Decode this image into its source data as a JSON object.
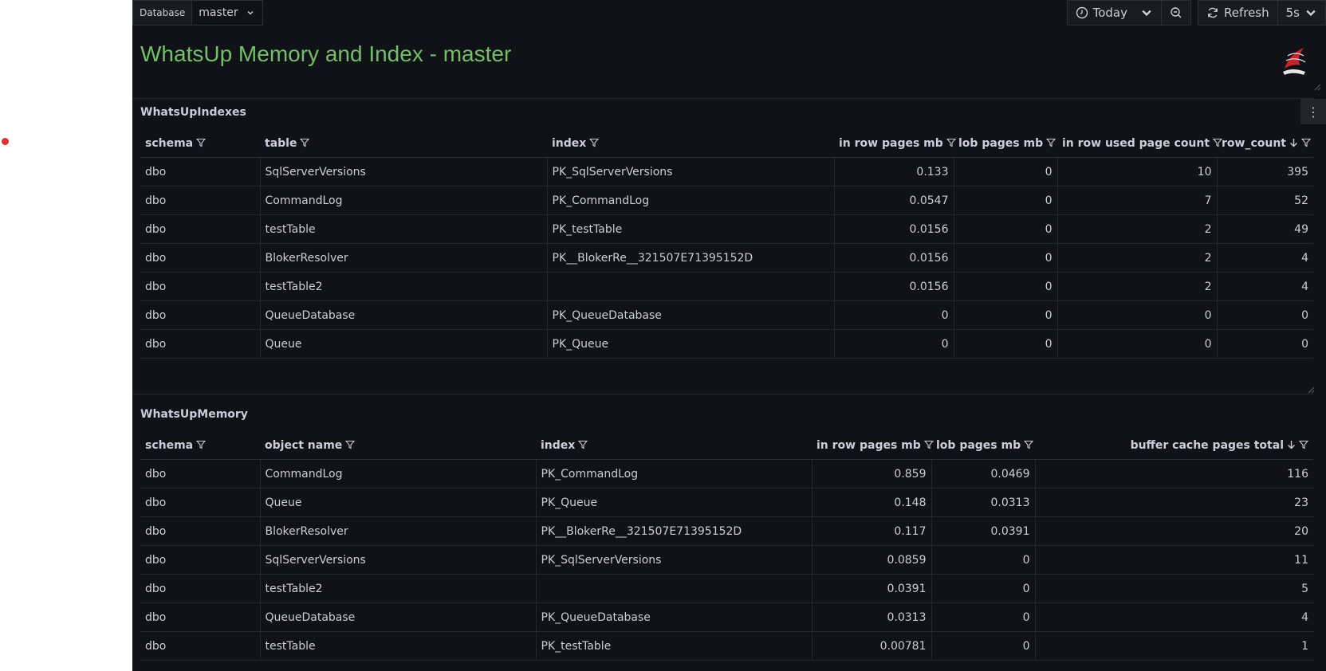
{
  "toolbar": {
    "variable_label": "Database",
    "variable_value": "master",
    "time_range": "Today",
    "refresh_label": "Refresh",
    "refresh_interval": "5s"
  },
  "title_panel": {
    "title": "WhatsUp Memory and Index - master",
    "logo_icon": "sql-server-icon"
  },
  "indexes_panel": {
    "title": "WhatsUpIndexes",
    "columns": [
      "schema",
      "table",
      "index",
      "in row pages mb",
      "lob pages mb",
      "in row used page count",
      "row_count"
    ],
    "sorted_column": "row_count",
    "rows": [
      [
        "dbo",
        "SqlServerVersions",
        "PK_SqlServerVersions",
        "0.133",
        "0",
        "10",
        "395"
      ],
      [
        "dbo",
        "CommandLog",
        "PK_CommandLog",
        "0.0547",
        "0",
        "7",
        "52"
      ],
      [
        "dbo",
        "testTable",
        "PK_testTable",
        "0.0156",
        "0",
        "2",
        "49"
      ],
      [
        "dbo",
        "BlokerResolver",
        "PK__BlokerRe__321507E71395152D",
        "0.0156",
        "0",
        "2",
        "4"
      ],
      [
        "dbo",
        "testTable2",
        "",
        "0.0156",
        "0",
        "2",
        "4"
      ],
      [
        "dbo",
        "QueueDatabase",
        "PK_QueueDatabase",
        "0",
        "0",
        "0",
        "0"
      ],
      [
        "dbo",
        "Queue",
        "PK_Queue",
        "0",
        "0",
        "0",
        "0"
      ]
    ]
  },
  "memory_panel": {
    "title": "WhatsUpMemory",
    "columns": [
      "schema",
      "object name",
      "index",
      "in row pages mb",
      "lob pages mb",
      "buffer cache pages total"
    ],
    "sorted_column": "buffer cache pages total",
    "rows": [
      [
        "dbo",
        "CommandLog",
        "PK_CommandLog",
        "0.859",
        "0.0469",
        "116"
      ],
      [
        "dbo",
        "Queue",
        "PK_Queue",
        "0.148",
        "0.0313",
        "23"
      ],
      [
        "dbo",
        "BlokerResolver",
        "PK__BlokerRe__321507E71395152D",
        "0.117",
        "0.0391",
        "20"
      ],
      [
        "dbo",
        "SqlServerVersions",
        "PK_SqlServerVersions",
        "0.0859",
        "0",
        "11"
      ],
      [
        "dbo",
        "testTable2",
        "",
        "0.0391",
        "0",
        "5"
      ],
      [
        "dbo",
        "QueueDatabase",
        "PK_QueueDatabase",
        "0.0313",
        "0",
        "4"
      ],
      [
        "dbo",
        "testTable",
        "PK_testTable",
        "0.00781",
        "0",
        "1"
      ]
    ]
  },
  "colors": {
    "background": "#111217",
    "title_green": "#73bf69",
    "text": "#ccccdc",
    "marker_red": "#e02f2f"
  }
}
